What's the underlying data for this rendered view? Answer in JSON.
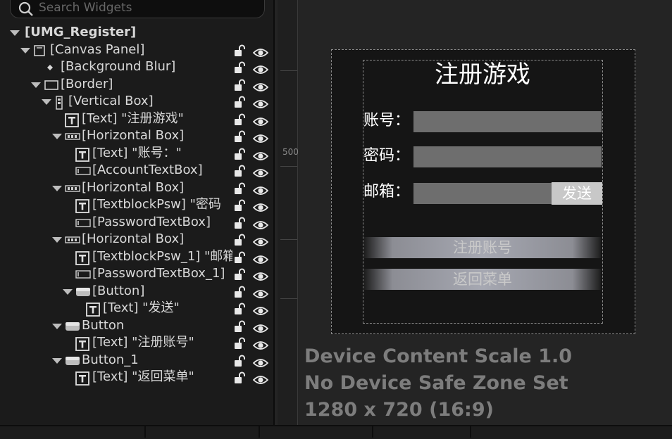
{
  "search": {
    "placeholder": "Search Widgets"
  },
  "hierarchy": [
    {
      "label": "[UMG_Register]",
      "depth": 0,
      "icon": "none",
      "expanded": true,
      "controls": false
    },
    {
      "label": "[Canvas Panel]",
      "depth": 1,
      "icon": "canvas-panel-icon",
      "expanded": true,
      "controls": true
    },
    {
      "label": "[Background Blur]",
      "depth": 2,
      "icon": "background-blur-icon",
      "expanded": null,
      "controls": true
    },
    {
      "label": "[Border]",
      "depth": 2,
      "icon": "border-icon",
      "expanded": true,
      "controls": true
    },
    {
      "label": "[Vertical Box]",
      "depth": 3,
      "icon": "vertical-box-icon",
      "expanded": true,
      "controls": true
    },
    {
      "label": "[Text] \"注册游戏\"",
      "depth": 4,
      "icon": "text-icon",
      "expanded": null,
      "controls": true
    },
    {
      "label": "[Horizontal Box]",
      "depth": 4,
      "icon": "horizontal-box-icon",
      "expanded": true,
      "controls": true
    },
    {
      "label": "[Text] \"账号：\"",
      "depth": 5,
      "icon": "text-icon",
      "expanded": null,
      "controls": true
    },
    {
      "label": "[AccountTextBox]",
      "depth": 5,
      "icon": "textbox-icon",
      "expanded": null,
      "controls": true
    },
    {
      "label": "[Horizontal Box]",
      "depth": 4,
      "icon": "horizontal-box-icon",
      "expanded": true,
      "controls": true
    },
    {
      "label": "[TextblockPsw] \"密码",
      "depth": 5,
      "icon": "text-icon",
      "expanded": null,
      "controls": true
    },
    {
      "label": "[PasswordTextBox]",
      "depth": 5,
      "icon": "textbox-icon",
      "expanded": null,
      "controls": true
    },
    {
      "label": "[Horizontal Box]",
      "depth": 4,
      "icon": "horizontal-box-icon",
      "expanded": true,
      "controls": true
    },
    {
      "label": "[TextblockPsw_1] \"邮箱",
      "depth": 5,
      "icon": "text-icon",
      "expanded": null,
      "controls": true
    },
    {
      "label": "[PasswordTextBox_1]",
      "depth": 5,
      "icon": "textbox-icon",
      "expanded": null,
      "controls": true
    },
    {
      "label": "[Button]",
      "depth": 5,
      "icon": "button-icon",
      "expanded": true,
      "controls": true
    },
    {
      "label": "[Text] \"发送\"",
      "depth": 6,
      "icon": "text-icon",
      "expanded": null,
      "controls": true
    },
    {
      "label": "Button",
      "depth": 4,
      "icon": "button-icon",
      "expanded": true,
      "controls": true
    },
    {
      "label": "[Text] \"注册账号\"",
      "depth": 5,
      "icon": "text-icon",
      "expanded": null,
      "controls": true
    },
    {
      "label": "Button_1",
      "depth": 4,
      "icon": "button-icon",
      "expanded": true,
      "controls": true
    },
    {
      "label": "[Text] \"返回菜单\"",
      "depth": 5,
      "icon": "text-icon",
      "expanded": null,
      "controls": true
    }
  ],
  "ruler": {
    "label": "500"
  },
  "preview": {
    "title": "注册游戏",
    "account_label": "账号：",
    "password_label": "密码：",
    "email_label": "邮箱：",
    "send_button": "发送",
    "register_button": "注册账号",
    "back_button": "返回菜单"
  },
  "info": {
    "scale": "Device Content Scale 1.0",
    "safe_zone": "No Device Safe Zone Set",
    "resolution": "1280 x 720 (16:9)"
  },
  "colors": {
    "field": "#6e6e6e",
    "send_button": "#c8c8c8",
    "text": "#ffffff",
    "info_text": "#7d7d7d"
  }
}
